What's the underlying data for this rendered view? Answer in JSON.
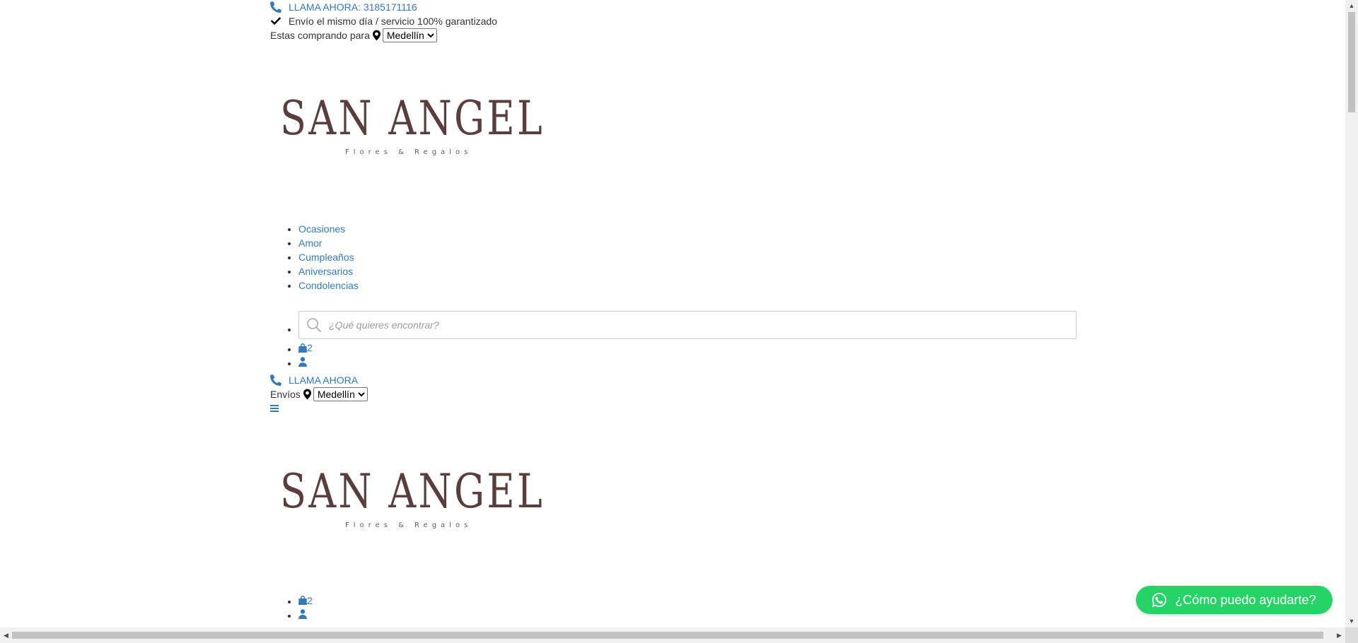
{
  "topbar": {
    "call_label": "LLAMA AHORA: 3185171116",
    "guarantee_text": "Envío el mismo día / servicio 100% garantizado",
    "shopping_for_label": "Estas comprando para",
    "city_selected": "Medellín"
  },
  "logo": {
    "brand": "SAN ANGEL",
    "tagline": "Flores & Regalos"
  },
  "nav": {
    "items": [
      {
        "label": "Ocasiones"
      },
      {
        "label": "Amor"
      },
      {
        "label": "Cumpleaños"
      },
      {
        "label": "Aniversarios"
      },
      {
        "label": "Condolencias"
      }
    ]
  },
  "search": {
    "placeholder": "¿Qué quieres encontrar?"
  },
  "cart": {
    "count": "2"
  },
  "mobile_header": {
    "call_label": "LLAMA AHORA",
    "shipping_label": "Envíos",
    "city_selected": "Medellín"
  },
  "mobile_cart": {
    "count": "2"
  },
  "whatsapp": {
    "label": "¿Cómo puedo ayudarte?",
    "color": "#25d366"
  },
  "colors": {
    "link": "#337ab7",
    "logo": "#5a3e3e"
  }
}
